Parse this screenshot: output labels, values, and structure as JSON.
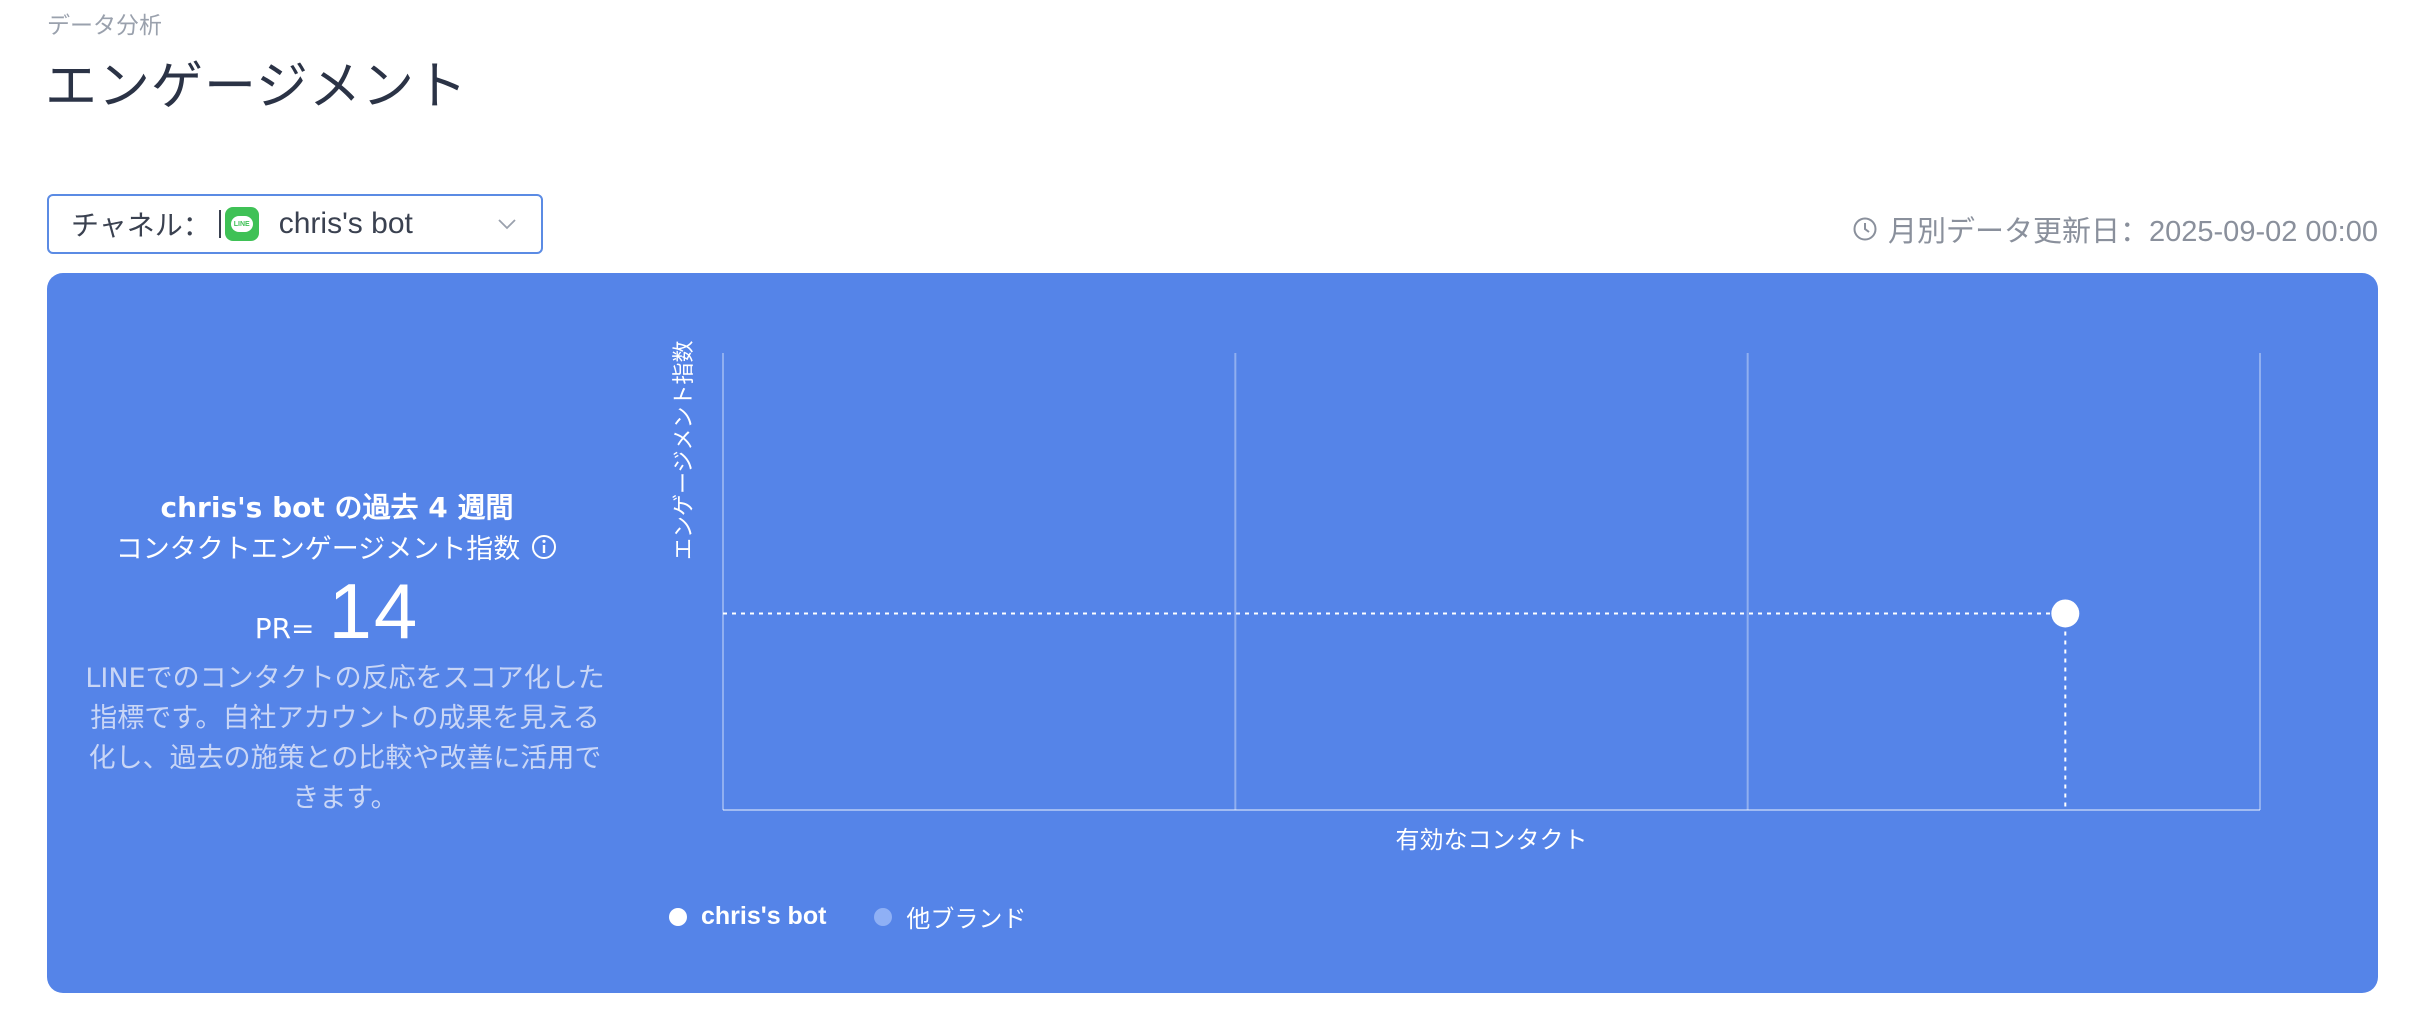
{
  "header": {
    "breadcrumb": "データ分析",
    "title": "エンゲージメント"
  },
  "channel": {
    "label": "チャネル：",
    "logo_text": "LINE",
    "value": "chris's bot"
  },
  "update_info": {
    "text": "月別データ更新日：2025-09-02 00:00"
  },
  "summary": {
    "title": "chris's bot の過去 4 週間",
    "subtitle": "コンタクトエンゲージメント指数",
    "pr_label": "PR=",
    "pr_value": "14",
    "description": "LINEでのコンタクトの反応をスコア化した指標です。自社アカウントの成果を見える化し、過去の施策との比較や改善に活用できます。"
  },
  "colors": {
    "panel": "#5584e8",
    "accent": "#5b8be4",
    "line_green": "#3fc156",
    "other_brand": "#8fb0f5"
  },
  "chart_data": {
    "type": "scatter",
    "xlabel": "有効なコンタクト",
    "ylabel": "エンゲージメント指数",
    "xlim": [
      0,
      3
    ],
    "ylim": [
      0,
      1
    ],
    "grid": true,
    "legend": "bottom-left",
    "series": [
      {
        "name": "chris's bot",
        "points": [
          [
            2.62,
            0.43
          ]
        ]
      },
      {
        "name": "他ブランド",
        "points": []
      }
    ]
  }
}
